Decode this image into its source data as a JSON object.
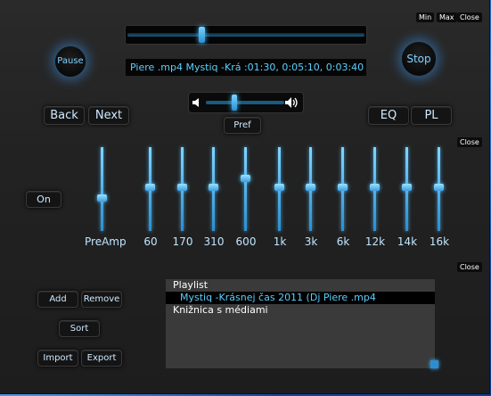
{
  "window": {
    "min_label": "Min",
    "max_label": "Max",
    "close_label": "Close"
  },
  "transport": {
    "pause_label": "Pause",
    "stop_label": "Stop",
    "back_label": "Back",
    "next_label": "Next"
  },
  "seek": {
    "position_fraction": 0.31
  },
  "now_playing": {
    "text": "Piere .mp4   Mystiq -Krá :01:30, 0:05:10, 0:03:40"
  },
  "volume": {
    "level_fraction": 0.35
  },
  "buttons": {
    "pref_label": "Pref",
    "eq_label": "EQ",
    "pl_label": "PL",
    "on_label": "On",
    "add_label": "Add",
    "remove_label": "Remove",
    "sort_label": "Sort",
    "import_label": "Import",
    "export_label": "Export"
  },
  "equalizer": {
    "close_label": "Close",
    "bands": [
      {
        "label": "PreAmp",
        "level": 0.62
      },
      {
        "label": "60",
        "level": 0.48
      },
      {
        "label": "170",
        "level": 0.48
      },
      {
        "label": "310",
        "level": 0.48
      },
      {
        "label": "600",
        "level": 0.36
      },
      {
        "label": "1k",
        "level": 0.48
      },
      {
        "label": "3k",
        "level": 0.48
      },
      {
        "label": "6k",
        "level": 0.48
      },
      {
        "label": "12k",
        "level": 0.48
      },
      {
        "label": "14k",
        "level": 0.48
      },
      {
        "label": "16k",
        "level": 0.48
      }
    ]
  },
  "playlist": {
    "close_label": "Close",
    "items": [
      {
        "text": "Playlist"
      },
      {
        "text": "Mystiq -Krásnej čas 2011  (Dj Piere .mp4"
      },
      {
        "text": "Knižnica s médiami"
      }
    ]
  },
  "colors": {
    "accent": "#5bd0ff",
    "panel": "#222222",
    "wallpaper": "#1a5cc0"
  }
}
